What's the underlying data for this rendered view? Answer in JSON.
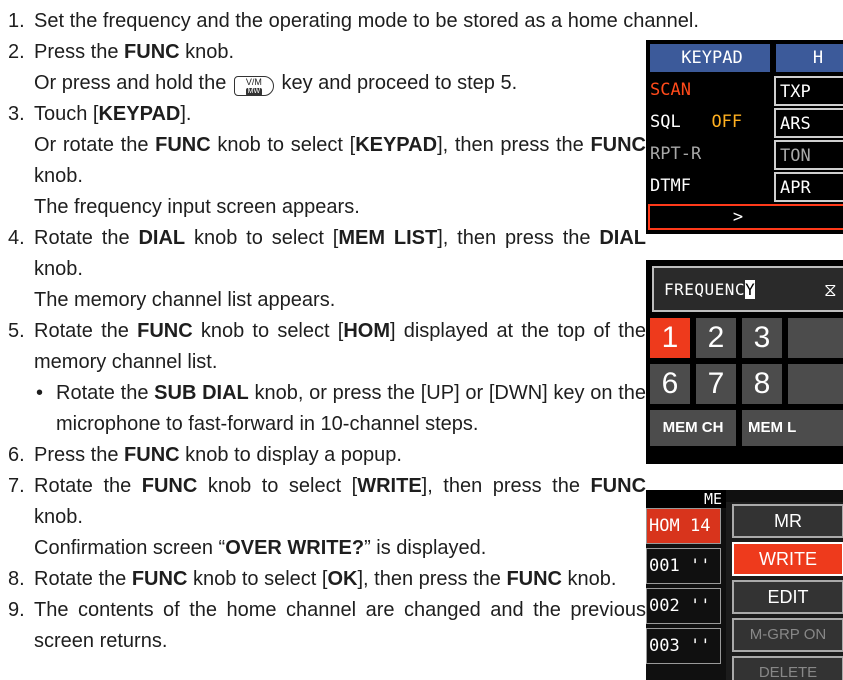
{
  "steps": [
    {
      "num": "1.",
      "text": "Set the frequency and the operating mode to be stored as a home channel."
    },
    {
      "num": "2.",
      "a": "Press the ",
      "b": "FUNC",
      "c": " knob.",
      "d": "Or press and hold the ",
      "e": " key and proceed to step 5."
    },
    {
      "num": "3.",
      "a": "Touch [",
      "b": "KEYPAD",
      "c": "].",
      "d": "Or rotate the ",
      "e": "FUNC",
      "f": " knob to select [",
      "g": "KEYPAD",
      "h": "], then press the ",
      "i": "FUNC",
      "j": " knob.",
      "k": "The frequency input screen appears."
    },
    {
      "num": "4.",
      "a": "Rotate the ",
      "b": "DIAL",
      "c": " knob to select [",
      "d": "MEM LIST",
      "e": "], then press the ",
      "f": "DIAL",
      "g": " knob.",
      "h": "The memory channel list appears."
    },
    {
      "num": "5.",
      "a": "Rotate the ",
      "b": "FUNC",
      "c": " knob to select [",
      "d": "HOM",
      "e": "] displayed at the top of the memory channel list.",
      "bullet": "•",
      "s1": "Rotate the ",
      "s2": "SUB DIAL",
      "s3": " knob, or press the [UP] or [DWN] key on the microphone to fast-forward in 10-channel steps."
    },
    {
      "num": "6.",
      "a": "Press the ",
      "b": "FUNC",
      "c": " knob to display a popup."
    },
    {
      "num": "7.",
      "a": "Rotate the ",
      "b": "FUNC",
      "c": " knob to select [",
      "d": "WRITE",
      "e": "], then press the ",
      "f": "FUNC",
      "g": " knob.",
      "h": "Confirmation screen “",
      "i": "OVER WRITE?",
      "j": "” is displayed."
    },
    {
      "num": "8.",
      "a": "Rotate the ",
      "b": "FUNC",
      "c": " knob to select [",
      "d": "OK",
      "e": "], then press the ",
      "f": "FUNC",
      "g": " knob."
    },
    {
      "num": "9.",
      "text": "The contents of the home channel are changed and the previous screen returns."
    }
  ],
  "key_icon": {
    "top": "V/M",
    "bottom": "MW"
  },
  "menu_screen": {
    "header_left": "KEYPAD",
    "header_right": "H",
    "rows": [
      {
        "left": "SCAN",
        "right": "TXP"
      },
      {
        "left": "SQL",
        "left_value": "OFF",
        "right": "ARS"
      },
      {
        "left": "RPT-R",
        "right": "TON"
      },
      {
        "left": "DTMF",
        "right": "APR"
      }
    ],
    "next_arrow": ">"
  },
  "freq_screen": {
    "label_prefix": "FREQUENC",
    "label_cursor": "Y",
    "cursor_glyph": "⧖",
    "keys": [
      "1",
      "2",
      "3",
      "6",
      "7",
      "8"
    ],
    "btn_left": "MEM CH",
    "btn_right": "MEM L"
  },
  "mem_screen": {
    "title": "ME",
    "rows": [
      {
        "ch": "HOM",
        "val": "14"
      },
      {
        "ch": "001",
        "val": "''"
      },
      {
        "ch": "002",
        "val": "''"
      },
      {
        "ch": "003",
        "val": "''"
      }
    ],
    "popup": [
      "MR",
      "WRITE",
      "EDIT",
      "M-GRP ON",
      "DELETE"
    ]
  },
  "colors": {
    "accent": "#ee3a1c",
    "header_blue": "#3c5a9a"
  }
}
